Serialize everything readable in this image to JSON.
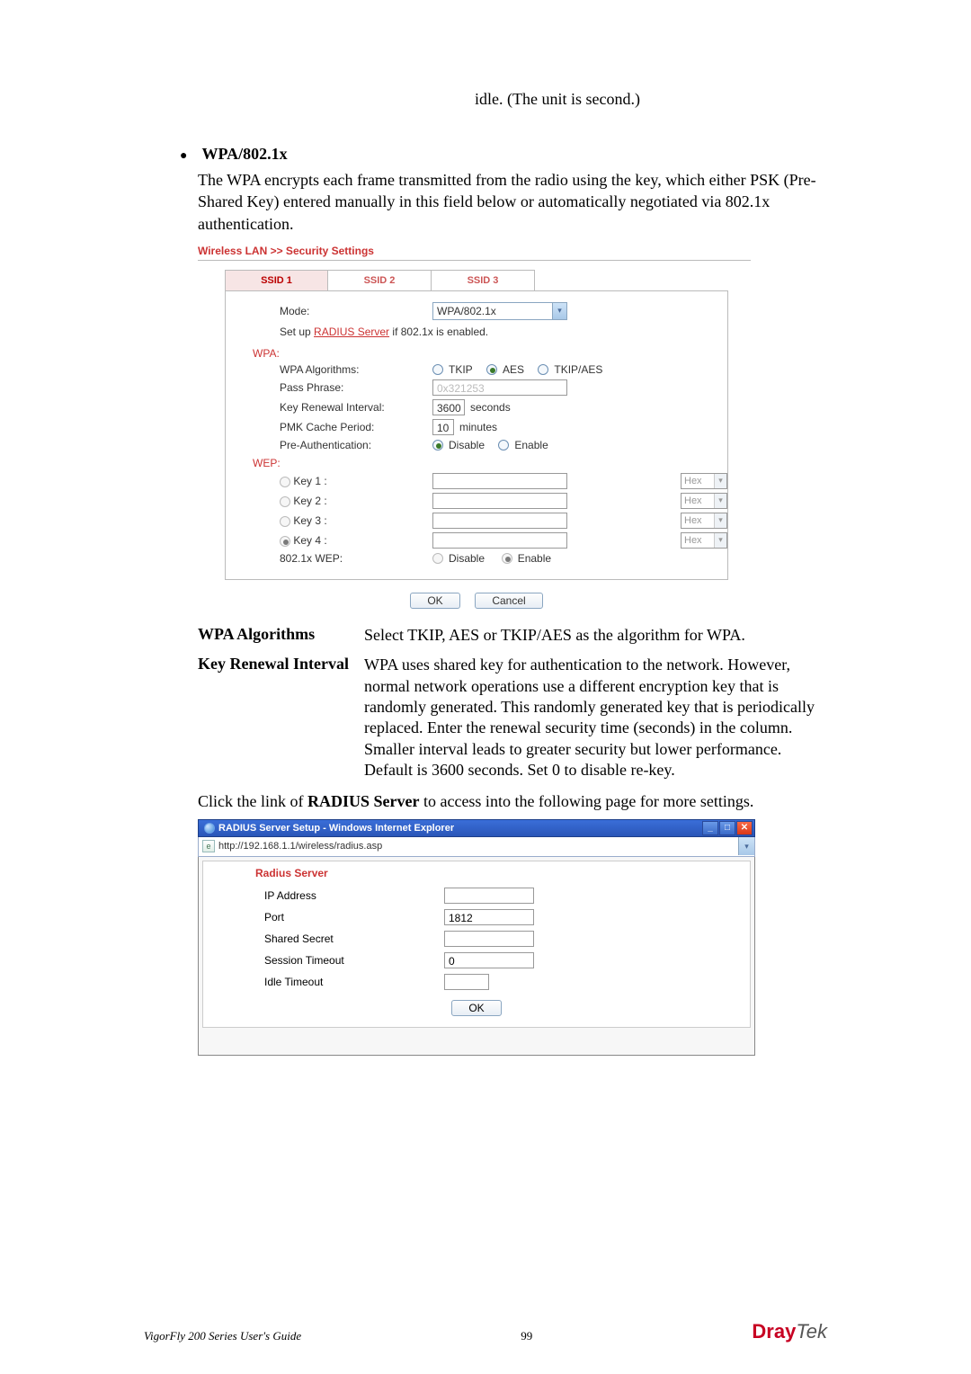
{
  "top_text": "idle. (The unit is second.)",
  "section": {
    "title": "WPA/802.1x",
    "intro": "The WPA encrypts each frame transmitted from the radio using the key, which either PSK (Pre-Shared Key) entered manually in this field below or automatically negotiated via 802.1x authentication."
  },
  "fig1": {
    "crumb": "Wireless LAN >> Security Settings",
    "tabs": [
      "SSID 1",
      "SSID 2",
      "SSID 3"
    ],
    "active_tab": 0,
    "mode": {
      "label": "Mode:",
      "value": "WPA/802.1x"
    },
    "setup_prefix": "Set up ",
    "setup_link": "RADIUS Server",
    "setup_suffix": " if 802.1x is enabled.",
    "wpa_section": "WPA:",
    "wpa_alg": {
      "label": "WPA Algorithms:",
      "opts": [
        "TKIP",
        "AES",
        "TKIP/AES"
      ],
      "selected": 1
    },
    "pass": {
      "label": "Pass Phrase:",
      "placeholder": "0x321253"
    },
    "renew": {
      "label": "Key Renewal Interval:",
      "value": "3600",
      "unit": "seconds"
    },
    "pmk": {
      "label": "PMK Cache Period:",
      "value": "10",
      "unit": "minutes"
    },
    "preauth": {
      "label": "Pre-Authentication:",
      "opts": [
        "Disable",
        "Enable"
      ],
      "selected": 0
    },
    "wep_section": "WEP:",
    "wep_keys": [
      {
        "label": "Key 1 :",
        "fmt": "Hex"
      },
      {
        "label": "Key 2 :",
        "fmt": "Hex"
      },
      {
        "label": "Key 3 :",
        "fmt": "Hex"
      },
      {
        "label": "Key 4 :",
        "fmt": "Hex"
      }
    ],
    "wep_selected": 3,
    "w8021x": {
      "label": "802.1x WEP:",
      "opts": [
        "Disable",
        "Enable"
      ],
      "selected": 1
    },
    "ok": "OK",
    "cancel": "Cancel"
  },
  "defs": [
    {
      "term": "WPA Algorithms",
      "desc": "Select TKIP, AES or TKIP/AES as the algorithm for WPA."
    },
    {
      "term": "Key Renewal Interval",
      "desc": "WPA uses shared key for authentication to the network. However, normal network operations use a different encryption key that is randomly generated. This randomly generated key that is periodically replaced. Enter the renewal security time (seconds) in the column. Smaller interval leads to greater security but lower performance. Default is 3600 seconds. Set 0 to disable re-key."
    }
  ],
  "radius_intro_prefix": "Click the link of ",
  "radius_intro_bold": "RADIUS Server",
  "radius_intro_suffix": " to access into the following page for more settings.",
  "fig2": {
    "window_title": "RADIUS Server Setup - Windows Internet Explorer",
    "url": "http://192.168.1.1/wireless/radius.asp",
    "header": "Radius Server",
    "rows": {
      "ip": {
        "label": "IP Address",
        "value": ""
      },
      "port": {
        "label": "Port",
        "value": "1812"
      },
      "secret": {
        "label": "Shared Secret",
        "value": ""
      },
      "session": {
        "label": "Session Timeout",
        "value": "0"
      },
      "idle": {
        "label": "Idle Timeout",
        "value": ""
      }
    },
    "ok": "OK"
  },
  "footer": {
    "guide": "VigorFly 200 Series User's Guide",
    "page": "99",
    "logo_dray": "Dray",
    "logo_tek": "Tek"
  }
}
